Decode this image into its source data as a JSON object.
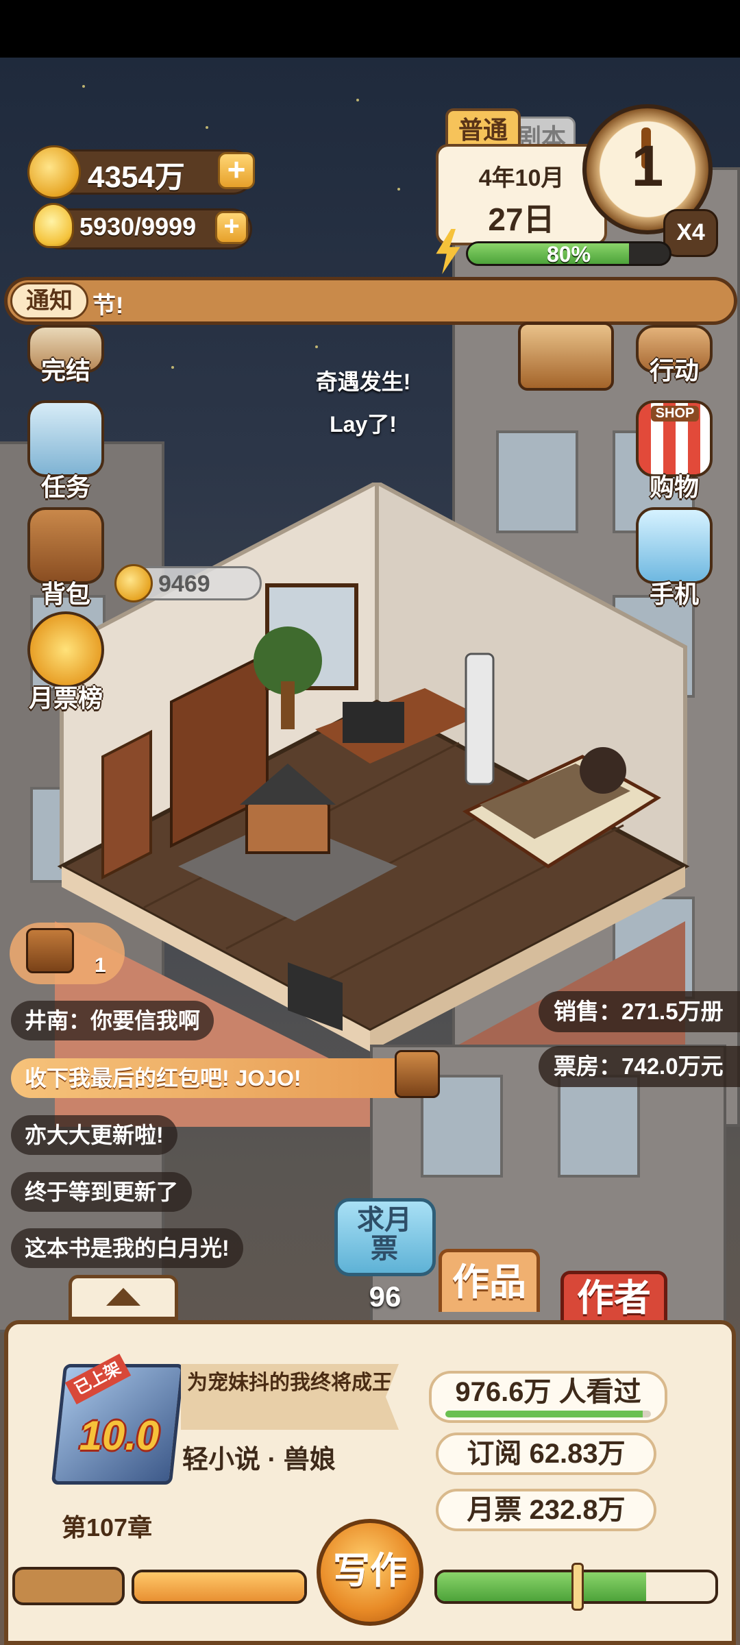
{
  "resources": {
    "gold": "4354万",
    "energy": "5930/9999",
    "plus": "+"
  },
  "calendar": {
    "mode_tab": "普通",
    "mode_tab_behind": "剧本",
    "month": "4年10月",
    "day": "27日",
    "clock_number": "1",
    "speed": "X4",
    "energy_percent_label": "80%",
    "energy_percent": 0.8
  },
  "notice": {
    "label": "通知",
    "text": "节!"
  },
  "left_menu": [
    {
      "label": "完结",
      "icon": "finished-book-icon"
    },
    {
      "label": "任务",
      "icon": "task-clipboard-icon"
    },
    {
      "label": "背包",
      "icon": "backpack-icon"
    },
    {
      "label": "月票榜",
      "icon": "monthly-ticket-medal-icon"
    }
  ],
  "right_menu": [
    {
      "label": "行动",
      "icon": "door-action-icon"
    },
    {
      "label": "购物",
      "icon": "shop-icon"
    },
    {
      "label": "手机",
      "icon": "phone-icon"
    }
  ],
  "shop_sign": "SHOP",
  "event": {
    "line1": "奇遇发生!",
    "line2": "Lay了!"
  },
  "backpack_coins": "9469",
  "treasure_count": "1",
  "chat_messages": [
    {
      "text": "井南：你要信我啊",
      "style": "dark"
    },
    {
      "text": "收下我最后的红包吧! JOJO!",
      "style": "gold"
    },
    {
      "text": "亦大大更新啦!",
      "style": "dark"
    },
    {
      "text": "终于等到更新了",
      "style": "dark"
    },
    {
      "text": "这本书是我的白月光!",
      "style": "dark"
    }
  ],
  "sales_stats": {
    "sales": "销售：271.5万册",
    "box_office": "票房：742.0万元"
  },
  "ticket_request": {
    "label": "求月票",
    "count": "96"
  },
  "tabs": {
    "works": "作品",
    "author": "作者"
  },
  "book": {
    "status_badge": "已上架",
    "rating": "10.0",
    "title": "为宠妹抖的我终将成王",
    "genre": "轻小说 · 兽娘",
    "chapter": "第107章",
    "readers": "976.6万 人看过",
    "readers_fill": 0.96,
    "subscriptions": "订阅 62.83万",
    "monthly_tickets": "月票 232.8万"
  },
  "write_button": "写作",
  "progress": {
    "left_fill": 1.0,
    "right_fill": 0.75
  },
  "colors": {
    "wood_dark": "#5a3b22",
    "panel_bg": "#f7ecd8",
    "works_tab": "#f0b070",
    "author_tab": "#d84838",
    "energy_green": "#4da33a",
    "ticket_blue": "#7cc6e6"
  }
}
